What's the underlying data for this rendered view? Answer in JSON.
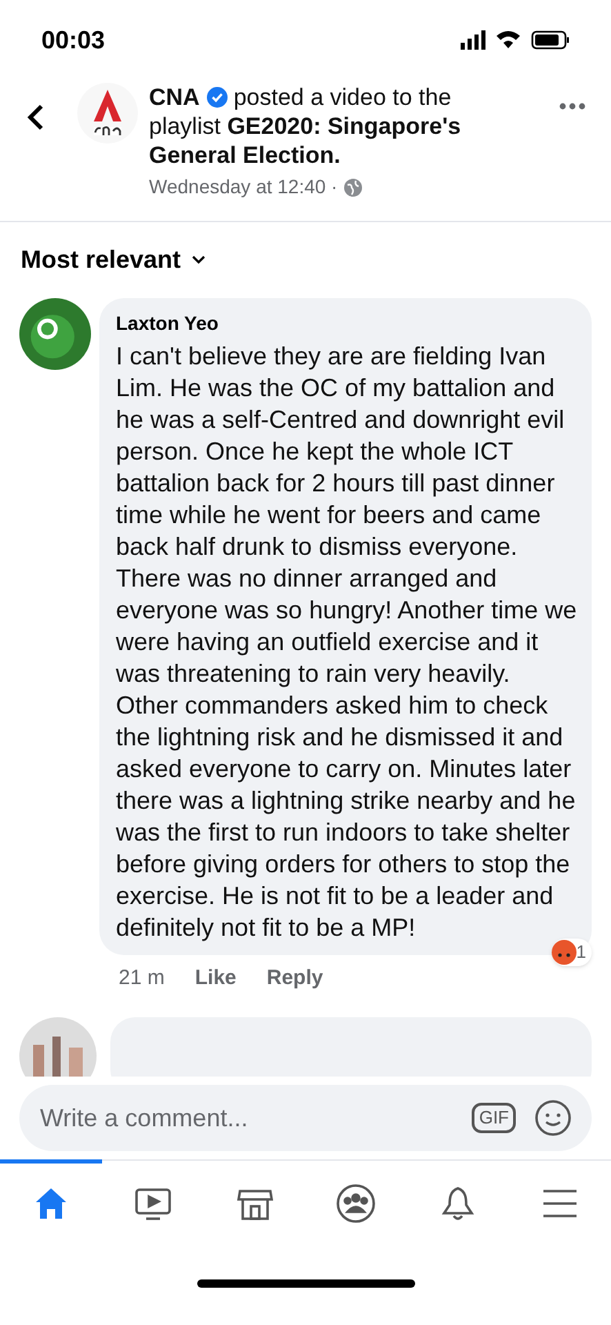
{
  "status_bar": {
    "time": "00:03"
  },
  "post": {
    "page": "CNA",
    "verified": true,
    "action": "posted a video to the playlist",
    "playlist": "GE2020: Singapore's General Election.",
    "time": "Wednesday at 12:40 ·"
  },
  "sort": {
    "label": "Most relevant"
  },
  "comments": [
    {
      "author": "Laxton Yeo",
      "text": "I can't believe they are are fielding Ivan Lim. He was the OC of my battalion and he was a self-Centred and downright evil person. Once he kept the whole ICT battalion back for 2 hours till past dinner time while he went for beers and came back half drunk to dismiss everyone. There was no dinner arranged and everyone was so hungry! Another time we were having an outfield exercise and it was threatening to rain very heavily. Other commanders asked him to check the lightning risk and he dismissed it and asked everyone to carry on. Minutes later there was a lightning strike nearby and he was the first to run indoors to take shelter before giving orders for others to stop the exercise. He is not fit to be a leader and definitely not fit to be a MP!",
      "age": "21 m",
      "like": "Like",
      "reply": "Reply",
      "reaction_count": "1"
    }
  ],
  "composer": {
    "placeholder": "Write a comment...",
    "gif": "GIF"
  },
  "nav": [
    {
      "kind": "home",
      "selected": true
    },
    {
      "kind": "video",
      "selected": false
    },
    {
      "kind": "market",
      "selected": false
    },
    {
      "kind": "groups",
      "selected": false
    },
    {
      "kind": "bell",
      "selected": false
    },
    {
      "kind": "menu",
      "selected": false
    }
  ]
}
